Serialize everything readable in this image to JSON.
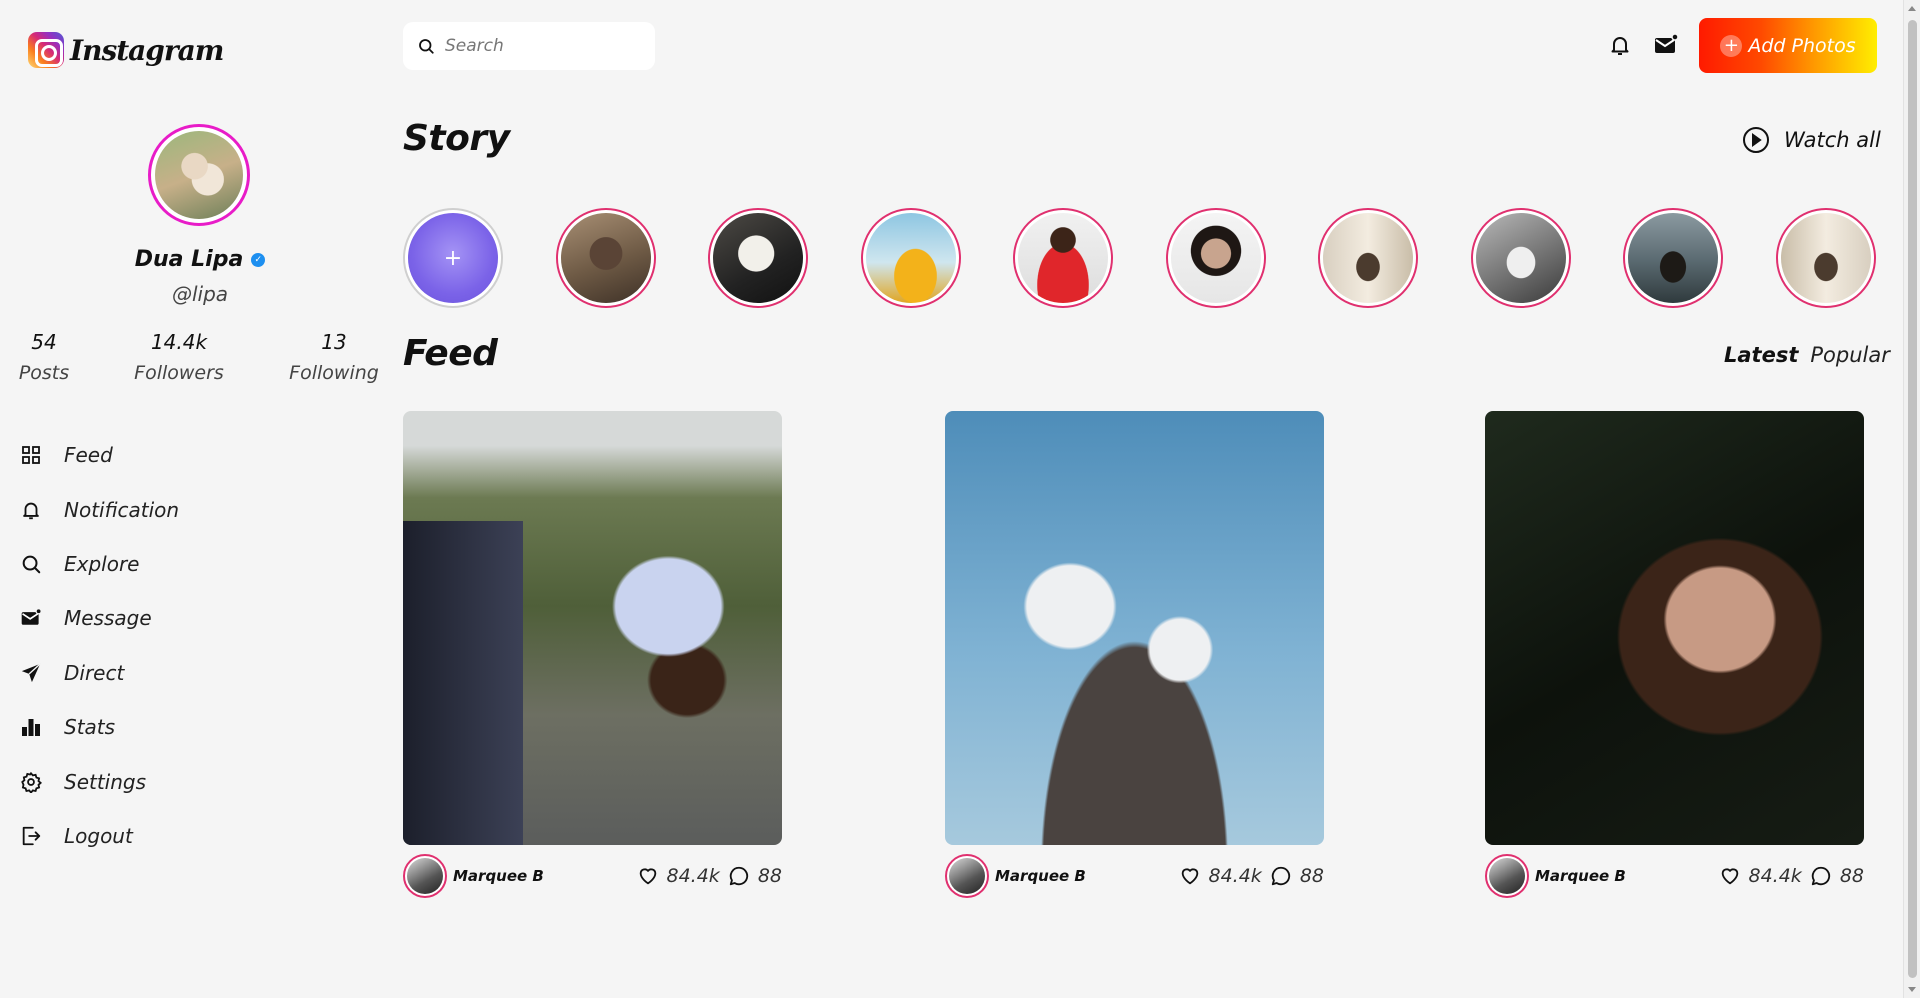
{
  "app": {
    "logo_text": "Instagram"
  },
  "header": {
    "search_placeholder": "Search",
    "add_photos_label": "Add Photos",
    "accent_gradient": [
      "#ff1a00",
      "#ffee00"
    ]
  },
  "profile": {
    "name": "Dua Lipa",
    "handle": "@lipa",
    "verified": true,
    "stats": [
      {
        "value": "54",
        "label": "Posts"
      },
      {
        "value": "14.4k",
        "label": "Followers"
      },
      {
        "value": "13",
        "label": "Following"
      }
    ]
  },
  "nav": [
    {
      "label": "Feed",
      "icon": "grid-icon"
    },
    {
      "label": "Notification",
      "icon": "bell-icon"
    },
    {
      "label": "Explore",
      "icon": "search-icon"
    },
    {
      "label": "Message",
      "icon": "mail-icon"
    },
    {
      "label": "Direct",
      "icon": "send-icon"
    },
    {
      "label": "Stats",
      "icon": "bar-chart-icon"
    },
    {
      "label": "Settings",
      "icon": "gear-icon"
    },
    {
      "label": "Logout",
      "icon": "logout-icon"
    }
  ],
  "story": {
    "title": "Story",
    "watch_all": "Watch all",
    "ring_color": "#e0306f"
  },
  "feed": {
    "title": "Feed",
    "tabs": [
      "Latest",
      "Popular"
    ],
    "active_tab": "Latest",
    "posts": [
      {
        "user": "Marquee B",
        "likes": "84.4k",
        "comments": "88"
      },
      {
        "user": "Marquee B",
        "likes": "84.4k",
        "comments": "88"
      },
      {
        "user": "Marquee B",
        "likes": "84.4k",
        "comments": "88"
      }
    ]
  }
}
